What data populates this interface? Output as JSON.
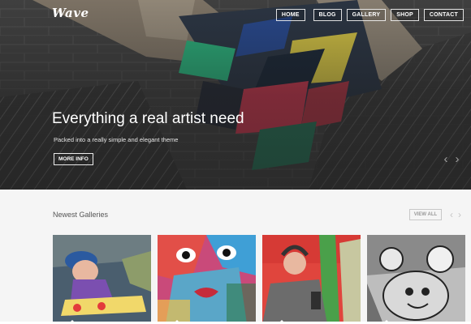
{
  "header": {
    "logo": "Wave",
    "nav": [
      "HOME",
      "BLOG",
      "GALLERY",
      "SHOP",
      "CONTACT"
    ]
  },
  "hero": {
    "title": "Everything a real artist need",
    "subtitle": "Packed into a really simple and elegant theme",
    "button": "MORE INFO",
    "prev_icon": "chevron-left-icon",
    "next_icon": "chevron-right-icon"
  },
  "galleries": {
    "title": "Newest Galleries",
    "view_all": "VIEW ALL",
    "items": [
      {
        "name": "gallery-thumb-1"
      },
      {
        "name": "gallery-thumb-2"
      },
      {
        "name": "gallery-thumb-3"
      },
      {
        "name": "gallery-thumb-4"
      }
    ]
  },
  "colors": {
    "hero_dark": "#3a3a3a",
    "cube_yellow": "#e6d44a",
    "cube_green": "#2fbf86",
    "cube_red": "#d23d55",
    "cube_blue": "#3a56a8",
    "background": "#f5f5f5"
  }
}
